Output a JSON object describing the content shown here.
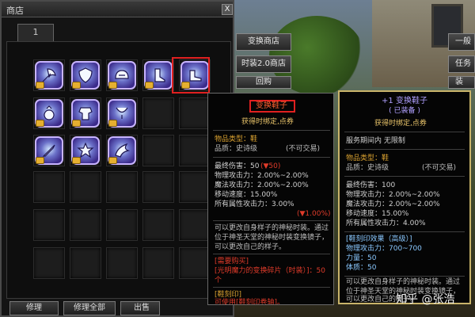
{
  "shop": {
    "title": "商店",
    "close_label": "X",
    "tab_label": "1",
    "buttons": [
      "修理",
      "修理全部",
      "出售"
    ]
  },
  "side_buttons": [
    "变换商店",
    "时装2.0商店",
    "回购"
  ],
  "right_buttons": [
    "一般",
    "任务",
    "装"
  ],
  "tooltip_left": {
    "name": "变换鞋子",
    "bind_status": "获得时绑定,点券",
    "type_label": "物品类型：鞋",
    "quality_label": "品质：史诗级",
    "trade_label": "(不可交易)",
    "stat_damage": "最终伤害：50",
    "stat_damage_delta": "(▼50)",
    "stat_phys": "物理攻击力：2.00%~2.00%",
    "stat_magic": "魔法攻击力：2.00%~2.00%",
    "stat_speed": "移动速度：15.00%",
    "stat_all": "所有属性攻击力：3.00%",
    "stat_all_delta": "(▼1.00%)",
    "desc1": "可以更改自身样子的神秘时装。通过",
    "desc2": "位于神圣天堂的神秘时装变换镜子，",
    "desc3": "可以更改自己的样子。",
    "req_header": "[需要购买]",
    "req_text": "[光明魔力的变换碎片（时装）]：50",
    "req_text2": "个",
    "seal_header": "[鞋刻印]",
    "seal_text": "可使用[鞋刻印卷轴]。"
  },
  "tooltip_right": {
    "name": "+1 变换鞋子",
    "equipped": "( 已装备 )",
    "bind_status": "获得时绑定,点券",
    "server_bind": "服务期间内 无限制",
    "type_label": "物品类型：鞋",
    "quality_label": "品质：史诗级",
    "trade_label": "(不可交易)",
    "stat_damage": "最终伤害：100",
    "stat_phys": "物理攻击力：2.00%~2.00%",
    "stat_magic": "魔法攻击力：2.00%~2.00%",
    "stat_speed": "移动速度：15.00%",
    "stat_all": "所有属性攻击力：4.00%",
    "seal_header": "[鞋刻印效果（高级）]",
    "seal_phys": "物理攻击力：700~700",
    "seal_str": "力量：50",
    "seal_vit": "体质：50",
    "desc1": "可以更改自身样子的神秘时装。通过",
    "desc2": "位于神圣天堂的神秘时装变换镜子，",
    "desc3": "可以更改自己的样子。"
  },
  "watermark": "知乎 @张浩",
  "colors": {
    "item_border": "#c8b4ff",
    "highlight": "#e02020",
    "epic_name": "#ff6030",
    "equipped_name": "#b0a0ff"
  },
  "icons": [
    "axe-icon",
    "shield-icon",
    "helmet-icon",
    "boots-icon",
    "shoes-icon",
    "ring-icon",
    "armor-icon",
    "necklace-icon",
    "sword-icon",
    "star-icon",
    "wing-icon"
  ]
}
